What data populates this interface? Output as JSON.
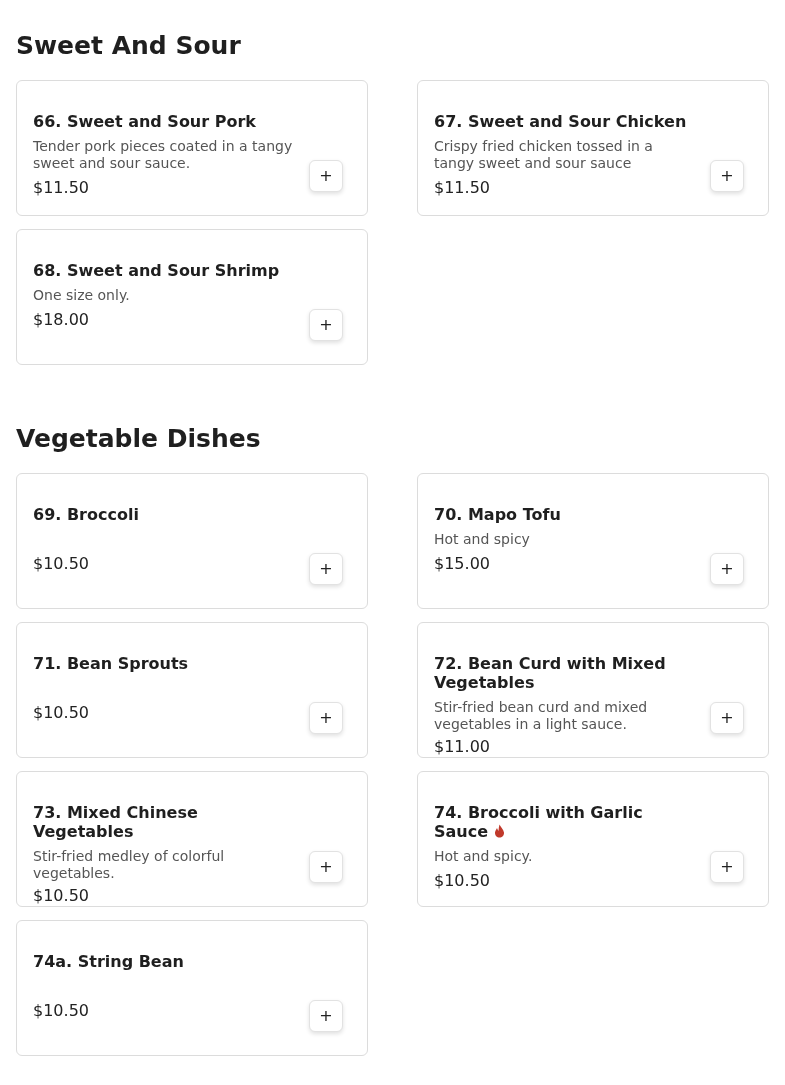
{
  "sections": [
    {
      "title": "Sweet And Sour",
      "items": [
        {
          "name": "66. Sweet and Sour Pork",
          "description": "Tender pork pieces coated in a tangy sweet and sour sauce.",
          "price": "$11.50",
          "spicy": false,
          "add": "+"
        },
        {
          "name": "67. Sweet and Sour Chicken",
          "description": "Crispy fried chicken tossed in a tangy sweet and sour sauce",
          "price": "$11.50",
          "spicy": false,
          "add": "+"
        },
        {
          "name": "68. Sweet and Sour Shrimp",
          "description": "One size only.",
          "price": "$18.00",
          "spicy": false,
          "add": "+"
        }
      ]
    },
    {
      "title": "Vegetable Dishes",
      "items": [
        {
          "name": "69. Broccoli",
          "price": "$10.50",
          "spicy": false,
          "add": "+"
        },
        {
          "name": "70. Mapo Tofu",
          "description": "Hot and spicy",
          "price": "$15.00",
          "spicy": false,
          "add": "+"
        },
        {
          "name": "71. Bean Sprouts",
          "price": "$10.50",
          "spicy": false,
          "add": "+"
        },
        {
          "name": "72. Bean Curd with Mixed Vegetables",
          "description": "Stir-fried bean curd and mixed vegetables in a light sauce.",
          "price": "$11.00",
          "spicy": false,
          "add": "+"
        },
        {
          "name": "73. Mixed Chinese Vegetables",
          "description": "Stir-fried medley of colorful vegetables.",
          "price": "$10.50",
          "spicy": false,
          "add": "+"
        },
        {
          "name": "74. Broccoli with Garlic Sauce",
          "description": "Hot and spicy.",
          "price": "$10.50",
          "spicy": true,
          "add": "+"
        },
        {
          "name": "74a. String Bean",
          "price": "$10.50",
          "spicy": false,
          "add": "+"
        }
      ]
    }
  ]
}
